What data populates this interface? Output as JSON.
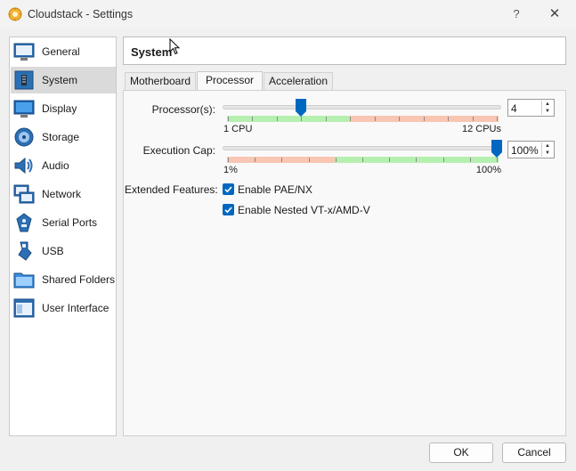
{
  "window": {
    "title": "Cloudstack - Settings",
    "help": "?",
    "close": "✕"
  },
  "sidebar": {
    "items": [
      {
        "label": "General",
        "icon": "general-icon"
      },
      {
        "label": "System",
        "icon": "system-icon"
      },
      {
        "label": "Display",
        "icon": "display-icon"
      },
      {
        "label": "Storage",
        "icon": "storage-icon"
      },
      {
        "label": "Audio",
        "icon": "audio-icon"
      },
      {
        "label": "Network",
        "icon": "network-icon"
      },
      {
        "label": "Serial Ports",
        "icon": "serial-port-icon"
      },
      {
        "label": "USB",
        "icon": "usb-icon"
      },
      {
        "label": "Shared Folders",
        "icon": "folder-icon"
      },
      {
        "label": "User Interface",
        "icon": "user-interface-icon"
      }
    ],
    "selected": "System"
  },
  "header": {
    "title": "System"
  },
  "tabs": [
    {
      "label": "Motherboard"
    },
    {
      "label": "Processor"
    },
    {
      "label": "Acceleration"
    }
  ],
  "active_tab": "Processor",
  "processor": {
    "label": "Processor(s):",
    "min_label": "1 CPU",
    "max_label": "12 CPUs",
    "value": "4",
    "min": 1,
    "max": 12,
    "current": 4
  },
  "execution_cap": {
    "label": "Execution Cap:",
    "min_label": "1%",
    "max_label": "100%",
    "value": "100%",
    "min": 1,
    "max": 100,
    "current": 100
  },
  "extended_features": {
    "label": "Extended Features:",
    "options": [
      {
        "label": "Enable PAE/NX",
        "checked": true
      },
      {
        "label": "Enable Nested VT-x/AMD-V",
        "checked": true
      }
    ]
  },
  "buttons": {
    "ok": "OK",
    "cancel": "Cancel"
  },
  "colors": {
    "accent": "#0067c0",
    "green_zone": "#b6f0b0",
    "red_zone": "#f8c6b2",
    "selected_bg": "#dadada"
  }
}
